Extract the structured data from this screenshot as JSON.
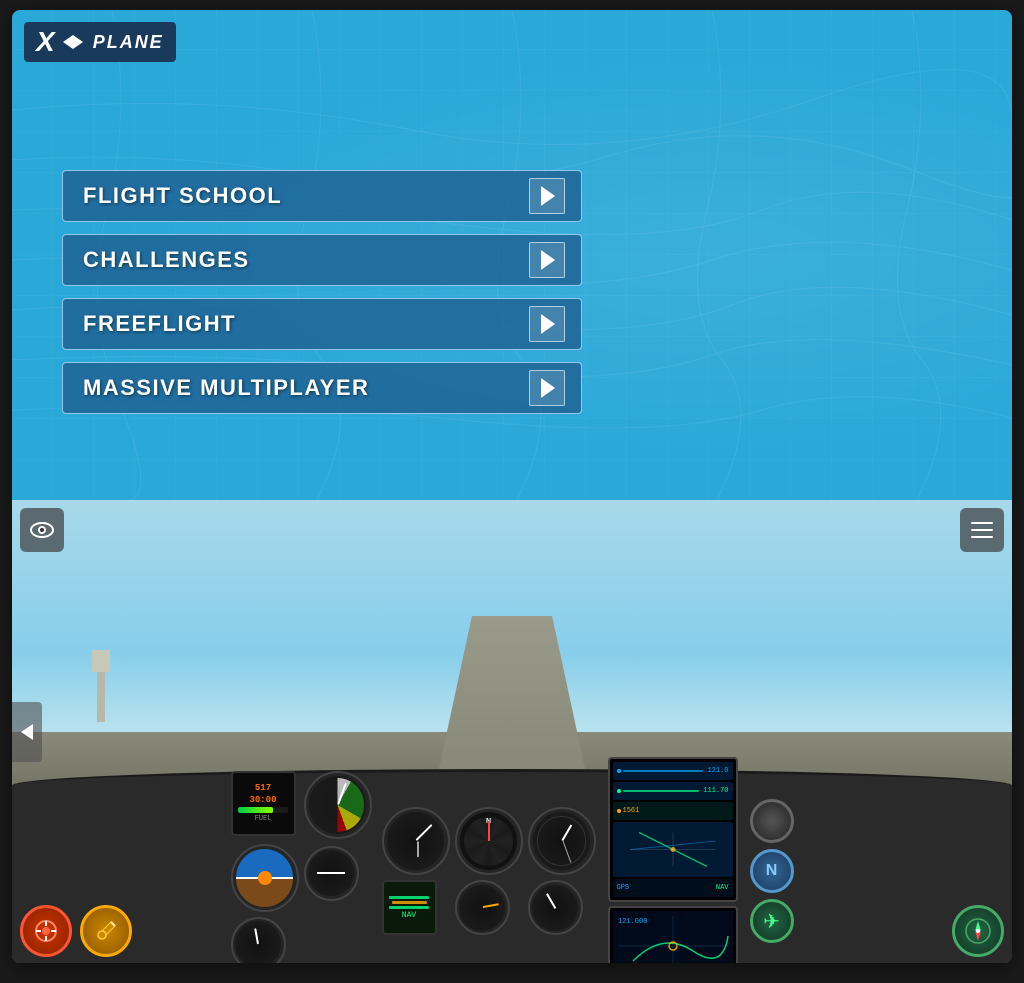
{
  "app": {
    "title": "X-Plane"
  },
  "logo": {
    "x": "X",
    "plane": "PLANE"
  },
  "menu": {
    "buttons": [
      {
        "id": "flight-school",
        "label": "FLIGHT SCHOOL"
      },
      {
        "id": "challenges",
        "label": "CHALLENGES"
      },
      {
        "id": "freeflight",
        "label": "FREEFLIGHT"
      },
      {
        "id": "massive-multiplayer",
        "label": "MASSIVE MULTIPLAYER"
      }
    ]
  },
  "cockpit": {
    "eye_label": "👁",
    "menu_label": "≡",
    "arrow_label": "❮",
    "autopilot_label": "⚙",
    "settings_label": "🔧"
  },
  "gps_rows": [
    {
      "color": "#00aaff",
      "label": "121.000"
    },
    {
      "color": "#00ff88",
      "label": "111.70"
    },
    {
      "color": "#ffaa00",
      "label": "1561"
    },
    {
      "color": "#00aaff",
      "label": "NAV"
    },
    {
      "color": "#00ff88",
      "label": "GPS"
    }
  ]
}
